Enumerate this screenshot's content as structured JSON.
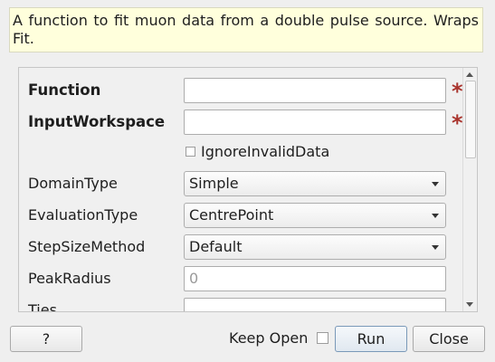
{
  "description": "A function to fit muon data from a double pulse source. Wraps Fit.",
  "properties": {
    "function": {
      "label": "Function",
      "value": ""
    },
    "input_workspace": {
      "label": "InputWorkspace",
      "value": ""
    },
    "ignore_invalid": {
      "label": "IgnoreInvalidData",
      "checked": false
    },
    "domain_type": {
      "label": "DomainType",
      "value": "Simple"
    },
    "evaluation_type": {
      "label": "EvaluationType",
      "value": "CentrePoint"
    },
    "step_size_method": {
      "label": "StepSizeMethod",
      "value": "Default"
    },
    "peak_radius": {
      "label": "PeakRadius",
      "placeholder": "0"
    },
    "ties": {
      "label": "Ties",
      "value": ""
    }
  },
  "required_marker": "*",
  "footer": {
    "help_label": "?",
    "keep_open_label": "Keep Open",
    "keep_open_checked": false,
    "run_label": "Run",
    "close_label": "Close"
  },
  "colors": {
    "description_bg": "#ffffdc",
    "required_star": "#a9342d"
  }
}
